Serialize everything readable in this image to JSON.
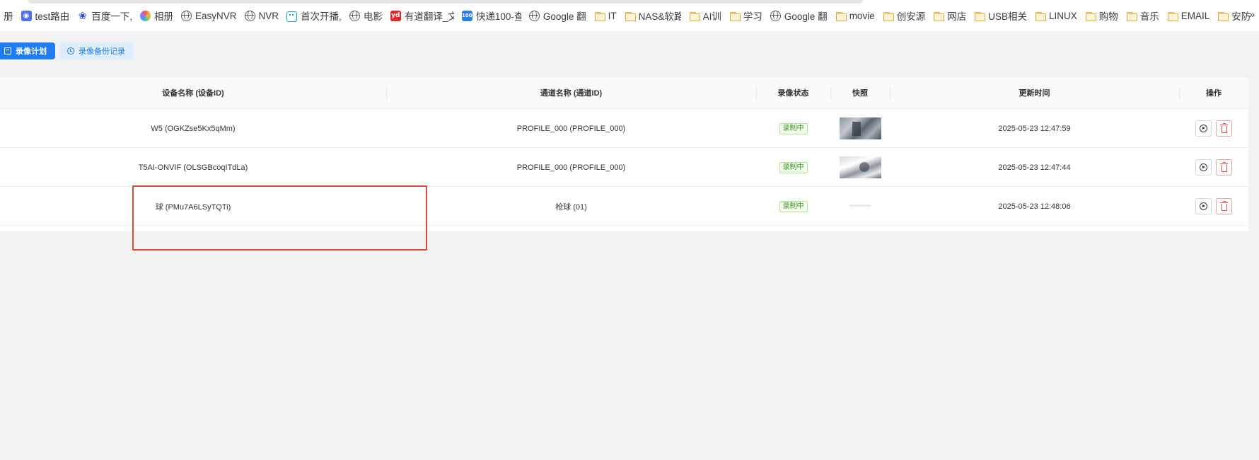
{
  "bookmarks": [
    {
      "label": "册",
      "icon": "none"
    },
    {
      "label": "test路由",
      "icon": "ghost-badge-icon",
      "color": "#4f6fe8"
    },
    {
      "label": "百度一下,",
      "icon": "baidu-paw-icon"
    },
    {
      "label": "相册",
      "icon": "photos-flower-icon"
    },
    {
      "label": "EasyNVR",
      "icon": "globe-icon"
    },
    {
      "label": "NVR",
      "icon": "globe-icon"
    },
    {
      "label": "首次开播,",
      "icon": "bilibili-tv-icon"
    },
    {
      "label": "电影",
      "icon": "globe-icon"
    },
    {
      "label": "有道翻译_文",
      "icon": "youdao-badge-icon",
      "badge": "yd",
      "color": "#e5252a"
    },
    {
      "label": "快递100-查",
      "icon": "kuaidi100-badge-icon",
      "badge": "100",
      "color": "#2b7fe0"
    },
    {
      "label": "Google 翻",
      "icon": "globe-icon"
    },
    {
      "label": "IT",
      "icon": "folder-icon"
    },
    {
      "label": "NAS&软路",
      "icon": "folder-icon"
    },
    {
      "label": "AI训",
      "icon": "folder-icon"
    },
    {
      "label": "学习",
      "icon": "folder-icon"
    },
    {
      "label": "Google 翻",
      "icon": "globe-icon"
    },
    {
      "label": "movie",
      "icon": "folder-icon"
    },
    {
      "label": "创安源",
      "icon": "folder-icon"
    },
    {
      "label": "网店",
      "icon": "folder-icon"
    },
    {
      "label": "USB相关",
      "icon": "folder-icon"
    },
    {
      "label": "LINUX",
      "icon": "folder-icon"
    },
    {
      "label": "购物",
      "icon": "folder-icon"
    },
    {
      "label": "音乐",
      "icon": "folder-icon"
    },
    {
      "label": "EMAIL",
      "icon": "folder-icon"
    },
    {
      "label": "安防",
      "icon": "folder-icon"
    }
  ],
  "bookmarks_more": "»",
  "toolbar": {
    "plan_label": "录像计划",
    "history_label": "录像备份记录"
  },
  "table": {
    "headers": {
      "device": "设备名称 (设备ID)",
      "channel": "通道名称 (通道ID)",
      "status": "录像状态",
      "snapshot": "快照",
      "updated": "更新时间",
      "actions": "操作"
    },
    "rows": [
      {
        "device": "W5 (OGKZse5Kx5qMm)",
        "channel": "PROFILE_000 (PROFILE_000)",
        "status": "录制中",
        "updated": "2025-05-23 12:47:59",
        "snapshot": "warehouse-camera-view"
      },
      {
        "device": "T5AI-ONVIF (OLSGBcoqITdLa)",
        "channel": "PROFILE_000 (PROFILE_000)",
        "status": "录制中",
        "updated": "2025-05-23 12:47:44",
        "snapshot": "office-camera-view"
      },
      {
        "device": "球 (PMu7A6LSyTQTi)",
        "channel": "枪球 (01)",
        "status": "录制中",
        "updated": "2025-05-23 12:48:06",
        "snapshot": "blank"
      }
    ]
  },
  "colors": {
    "primary": "#1f7cf2",
    "recording_tag": "#3a9b2a",
    "delete": "#e04b4b",
    "highlight": "#e0483c"
  }
}
